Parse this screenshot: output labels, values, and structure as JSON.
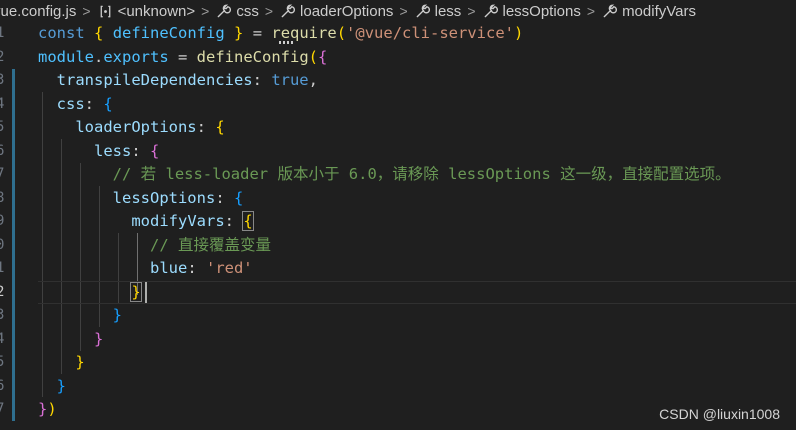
{
  "breadcrumb": {
    "file": "vue.config.js",
    "unknown": "<unknown>",
    "css": "css",
    "loader_options": "loaderOptions",
    "less": "less",
    "less_options": "lessOptions",
    "modify_vars": "modifyVars",
    "separator": ">"
  },
  "line_numbers": [
    "1",
    "2",
    "3",
    "4",
    "5",
    "6",
    "7",
    "8",
    "9",
    "0",
    "1",
    "2",
    "3",
    "4",
    "5",
    "6",
    "7"
  ],
  "code": {
    "l1": {
      "const": "const",
      "sp1": " ",
      "b1": "{",
      "name": " defineConfig ",
      "b2": "}",
      "eq": " = ",
      "require": "require",
      "p1": "(",
      "str": "'@vue/cli-service'",
      "p2": ")"
    },
    "l2": {
      "module": "module",
      "dot": ".",
      "exports": "exports",
      "eq": " = ",
      "fn": "defineConfig",
      "p1": "(",
      "b1": "{"
    },
    "l3": {
      "indent": "  ",
      "key": "transpileDependencies",
      "colon": ": ",
      "val": "true",
      "comma": ","
    },
    "l4": {
      "indent": "  ",
      "key": "css",
      "colon": ": ",
      "b": "{"
    },
    "l5": {
      "indent": "    ",
      "key": "loaderOptions",
      "colon": ": ",
      "b": "{"
    },
    "l6": {
      "indent": "      ",
      "key": "less",
      "colon": ": ",
      "b": "{"
    },
    "l7": {
      "indent": "        ",
      "comment": "// 若 less-loader 版本小于 6.0，请移除 lessOptions 这一级，直接配置选项。"
    },
    "l8": {
      "indent": "        ",
      "key": "lessOptions",
      "colon": ": ",
      "b": "{"
    },
    "l9": {
      "indent": "          ",
      "key": "modifyVars",
      "colon": ": ",
      "b": "{"
    },
    "l10": {
      "indent": "            ",
      "comment": "// 直接覆盖变量"
    },
    "l11": {
      "indent": "            ",
      "key": "blue",
      "colon": ": ",
      "str": "'red'"
    },
    "l12": {
      "indent": "          ",
      "b": "}"
    },
    "l13": {
      "indent": "        ",
      "b": "}"
    },
    "l14": {
      "indent": "      ",
      "b": "}"
    },
    "l15": {
      "indent": "    ",
      "b": "}"
    },
    "l16": {
      "indent": "  ",
      "b": "}"
    },
    "l17": {
      "b": "}",
      "p": ")"
    }
  },
  "watermark": "CSDN @liuxin1008",
  "colors": {
    "background": "#1f1f1f",
    "keyword": "#569cd6",
    "function": "#dcdcaa",
    "property": "#9cdcfe",
    "string": "#ce9178",
    "comment": "#6a9955",
    "bracket_gold": "#ffd700",
    "bracket_orchid": "#da70d6",
    "bracket_blue": "#179fff"
  },
  "icons": {
    "unknown": "symbol-namespace-icon",
    "css": "wrench-icon",
    "loader_options": "wrench-icon",
    "less": "wrench-icon",
    "less_options": "wrench-icon",
    "modify_vars": "wrench-icon"
  }
}
